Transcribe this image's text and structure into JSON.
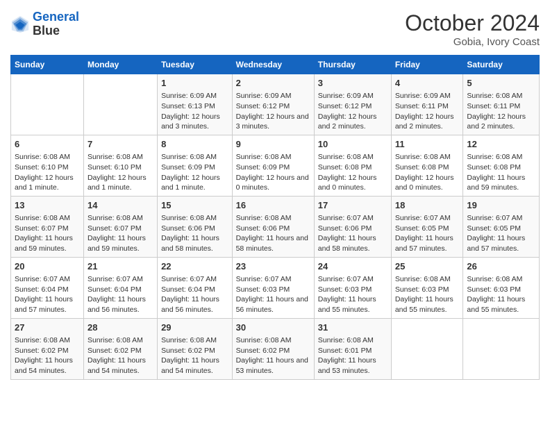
{
  "header": {
    "logo_line1": "General",
    "logo_line2": "Blue",
    "month": "October 2024",
    "location": "Gobia, Ivory Coast"
  },
  "weekdays": [
    "Sunday",
    "Monday",
    "Tuesday",
    "Wednesday",
    "Thursday",
    "Friday",
    "Saturday"
  ],
  "weeks": [
    [
      {
        "day": "",
        "content": ""
      },
      {
        "day": "",
        "content": ""
      },
      {
        "day": "1",
        "content": "Sunrise: 6:09 AM\nSunset: 6:13 PM\nDaylight: 12 hours and 3 minutes."
      },
      {
        "day": "2",
        "content": "Sunrise: 6:09 AM\nSunset: 6:12 PM\nDaylight: 12 hours and 3 minutes."
      },
      {
        "day": "3",
        "content": "Sunrise: 6:09 AM\nSunset: 6:12 PM\nDaylight: 12 hours and 2 minutes."
      },
      {
        "day": "4",
        "content": "Sunrise: 6:09 AM\nSunset: 6:11 PM\nDaylight: 12 hours and 2 minutes."
      },
      {
        "day": "5",
        "content": "Sunrise: 6:08 AM\nSunset: 6:11 PM\nDaylight: 12 hours and 2 minutes."
      }
    ],
    [
      {
        "day": "6",
        "content": "Sunrise: 6:08 AM\nSunset: 6:10 PM\nDaylight: 12 hours and 1 minute."
      },
      {
        "day": "7",
        "content": "Sunrise: 6:08 AM\nSunset: 6:10 PM\nDaylight: 12 hours and 1 minute."
      },
      {
        "day": "8",
        "content": "Sunrise: 6:08 AM\nSunset: 6:09 PM\nDaylight: 12 hours and 1 minute."
      },
      {
        "day": "9",
        "content": "Sunrise: 6:08 AM\nSunset: 6:09 PM\nDaylight: 12 hours and 0 minutes."
      },
      {
        "day": "10",
        "content": "Sunrise: 6:08 AM\nSunset: 6:08 PM\nDaylight: 12 hours and 0 minutes."
      },
      {
        "day": "11",
        "content": "Sunrise: 6:08 AM\nSunset: 6:08 PM\nDaylight: 12 hours and 0 minutes."
      },
      {
        "day": "12",
        "content": "Sunrise: 6:08 AM\nSunset: 6:08 PM\nDaylight: 11 hours and 59 minutes."
      }
    ],
    [
      {
        "day": "13",
        "content": "Sunrise: 6:08 AM\nSunset: 6:07 PM\nDaylight: 11 hours and 59 minutes."
      },
      {
        "day": "14",
        "content": "Sunrise: 6:08 AM\nSunset: 6:07 PM\nDaylight: 11 hours and 59 minutes."
      },
      {
        "day": "15",
        "content": "Sunrise: 6:08 AM\nSunset: 6:06 PM\nDaylight: 11 hours and 58 minutes."
      },
      {
        "day": "16",
        "content": "Sunrise: 6:08 AM\nSunset: 6:06 PM\nDaylight: 11 hours and 58 minutes."
      },
      {
        "day": "17",
        "content": "Sunrise: 6:07 AM\nSunset: 6:06 PM\nDaylight: 11 hours and 58 minutes."
      },
      {
        "day": "18",
        "content": "Sunrise: 6:07 AM\nSunset: 6:05 PM\nDaylight: 11 hours and 57 minutes."
      },
      {
        "day": "19",
        "content": "Sunrise: 6:07 AM\nSunset: 6:05 PM\nDaylight: 11 hours and 57 minutes."
      }
    ],
    [
      {
        "day": "20",
        "content": "Sunrise: 6:07 AM\nSunset: 6:04 PM\nDaylight: 11 hours and 57 minutes."
      },
      {
        "day": "21",
        "content": "Sunrise: 6:07 AM\nSunset: 6:04 PM\nDaylight: 11 hours and 56 minutes."
      },
      {
        "day": "22",
        "content": "Sunrise: 6:07 AM\nSunset: 6:04 PM\nDaylight: 11 hours and 56 minutes."
      },
      {
        "day": "23",
        "content": "Sunrise: 6:07 AM\nSunset: 6:03 PM\nDaylight: 11 hours and 56 minutes."
      },
      {
        "day": "24",
        "content": "Sunrise: 6:07 AM\nSunset: 6:03 PM\nDaylight: 11 hours and 55 minutes."
      },
      {
        "day": "25",
        "content": "Sunrise: 6:08 AM\nSunset: 6:03 PM\nDaylight: 11 hours and 55 minutes."
      },
      {
        "day": "26",
        "content": "Sunrise: 6:08 AM\nSunset: 6:03 PM\nDaylight: 11 hours and 55 minutes."
      }
    ],
    [
      {
        "day": "27",
        "content": "Sunrise: 6:08 AM\nSunset: 6:02 PM\nDaylight: 11 hours and 54 minutes."
      },
      {
        "day": "28",
        "content": "Sunrise: 6:08 AM\nSunset: 6:02 PM\nDaylight: 11 hours and 54 minutes."
      },
      {
        "day": "29",
        "content": "Sunrise: 6:08 AM\nSunset: 6:02 PM\nDaylight: 11 hours and 54 minutes."
      },
      {
        "day": "30",
        "content": "Sunrise: 6:08 AM\nSunset: 6:02 PM\nDaylight: 11 hours and 53 minutes."
      },
      {
        "day": "31",
        "content": "Sunrise: 6:08 AM\nSunset: 6:01 PM\nDaylight: 11 hours and 53 minutes."
      },
      {
        "day": "",
        "content": ""
      },
      {
        "day": "",
        "content": ""
      }
    ]
  ]
}
